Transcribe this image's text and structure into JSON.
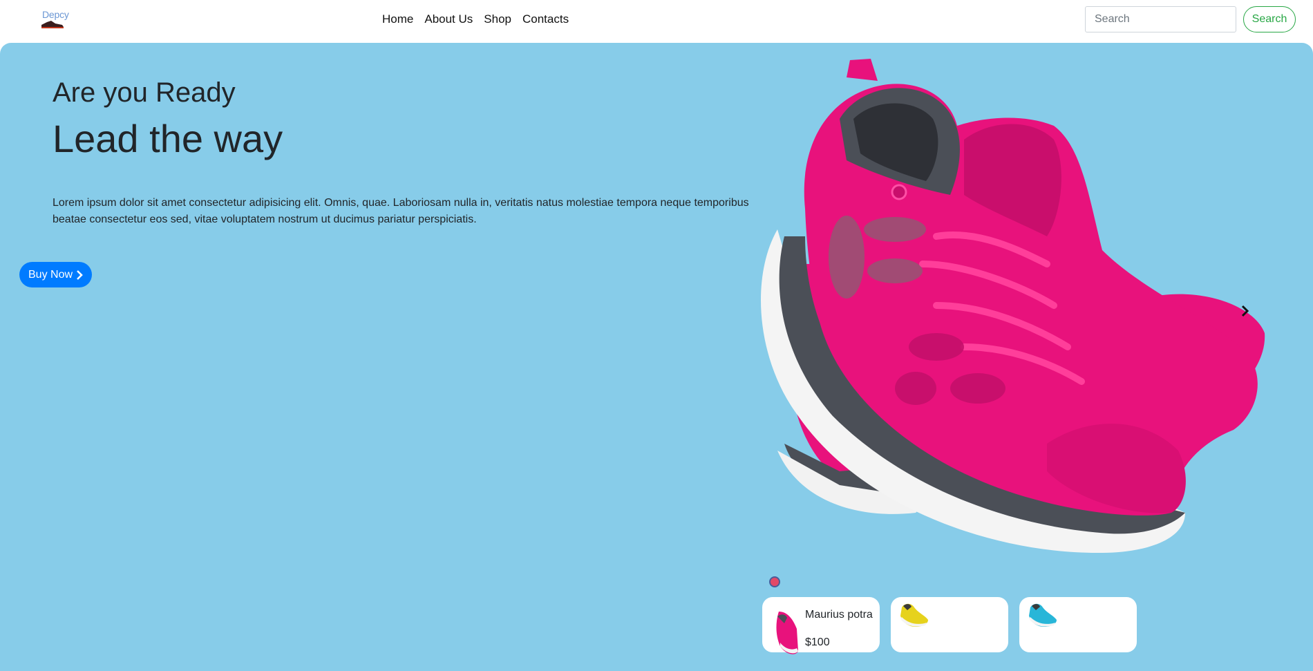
{
  "brand": {
    "name": "Depcy"
  },
  "nav": {
    "links": [
      "Home",
      "About Us",
      "Shop",
      "Contacts"
    ]
  },
  "search": {
    "placeholder": "Search",
    "button_label": "Search"
  },
  "hero": {
    "subtitle": "Are you Ready",
    "title": "Lead the way",
    "description": "Lorem ipsum dolor sit amet consectetur adipisicing elit. Omnis, quae. Laboriosam nulla in, veritatis natus molestiae tempora neque temporibus beatae consectetur eos sed, vitae voluptatem nostrum ut ducimus pariatur perspiciatis.",
    "cta_label": "Buy Now"
  },
  "carousel": {
    "product_cards": [
      {
        "name": "Maurius potra",
        "price": "$100",
        "shoe_color": "#e8127c"
      },
      {
        "name": "",
        "price": "",
        "shoe_color": "#e6d21c"
      },
      {
        "name": "",
        "price": "",
        "shoe_color": "#28b6d8"
      }
    ]
  },
  "colors": {
    "hero_bg": "#87cce9",
    "primary": "#007bff",
    "success": "#28a745",
    "shoe_pink": "#e8127c"
  }
}
